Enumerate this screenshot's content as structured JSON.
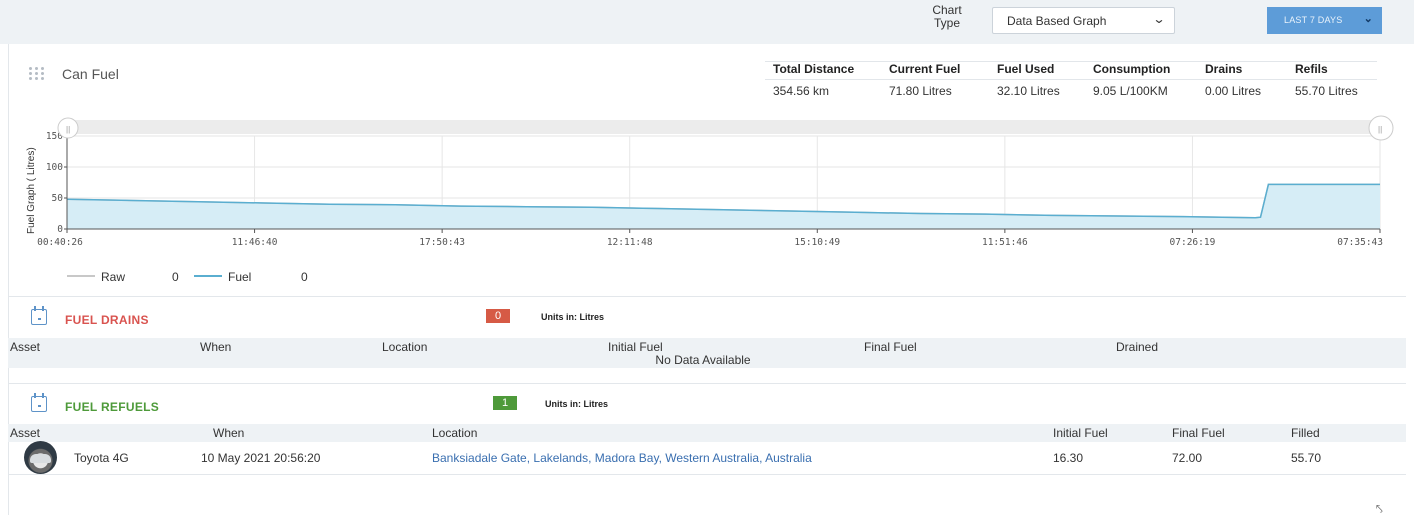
{
  "toolbar": {
    "chart_type_label": "Chart Type",
    "chart_type_value": "Data Based Graph",
    "range_label": "LAST 7 DAYS"
  },
  "panel": {
    "title": "Can Fuel"
  },
  "stats": [
    {
      "label": "Total Distance",
      "value": "354.56 km"
    },
    {
      "label": "Current Fuel",
      "value": "71.80 Litres"
    },
    {
      "label": "Fuel Used",
      "value": "32.10 Litres"
    },
    {
      "label": "Consumption",
      "value": "9.05 L/100KM"
    },
    {
      "label": "Drains",
      "value": "0.00 Litres"
    },
    {
      "label": "Refils",
      "value": "55.70 Litres"
    }
  ],
  "chart_data": {
    "type": "area",
    "ylabel": "Fuel Graph ( Litres)",
    "ylim": [
      0,
      150
    ],
    "yticks": [
      0,
      50,
      100,
      150
    ],
    "xticks": [
      "00:40:26",
      "11:46:40",
      "17:50:43",
      "12:11:48",
      "15:10:49",
      "11:51:46",
      "07:26:19",
      "07:35:43"
    ],
    "grid": true,
    "legend_position": "bottom-left",
    "colors": {
      "raw": "#c8c8c8",
      "fuel": "#5aaed0",
      "fill": "#d6edf6"
    },
    "x_position": [
      0,
      0.05,
      0.1,
      0.15,
      0.2,
      0.25,
      0.3,
      0.35,
      0.4,
      0.45,
      0.5,
      0.55,
      0.6,
      0.65,
      0.7,
      0.75,
      0.8,
      0.85,
      0.88,
      0.905,
      0.909,
      0.915,
      0.95,
      1.0
    ],
    "series": [
      {
        "name": "Raw",
        "legend_value": "0",
        "values": [
          48,
          46,
          44,
          42,
          40,
          39,
          37,
          36,
          35,
          33,
          31,
          29,
          27,
          25,
          24,
          22,
          21,
          20,
          19,
          18,
          19,
          72,
          72,
          72
        ]
      },
      {
        "name": "Fuel",
        "legend_value": "0",
        "values": [
          48,
          46,
          44,
          42,
          40,
          39,
          37,
          36,
          35,
          33,
          31,
          29,
          27,
          25,
          24,
          22,
          21,
          20,
          19,
          18,
          19,
          72,
          72,
          72
        ]
      }
    ]
  },
  "drains": {
    "title": "FUEL DRAINS",
    "count": "0",
    "units": "Units in: Litres",
    "columns": [
      "Asset",
      "When",
      "Location",
      "Initial Fuel",
      "Final Fuel",
      "Drained"
    ],
    "empty_message": "No Data Available",
    "badge_color": "#d65a45",
    "title_color": "#d9534f"
  },
  "refuels": {
    "title": "FUEL REFUELS",
    "count": "1",
    "units": "Units in: Litres",
    "columns": [
      "Asset",
      "When",
      "Location",
      "Initial Fuel",
      "Final Fuel",
      "Filled"
    ],
    "badge_color": "#4e9a3a",
    "title_color": "#4e9a3a",
    "rows": [
      {
        "asset": "Toyota 4G",
        "when": "10 May 2021 20:56:20",
        "location": "Banksiadale Gate, Lakelands, Madora Bay, Western Australia, Australia",
        "initial": "16.30",
        "final": "72.00",
        "filled": "55.70"
      }
    ]
  }
}
